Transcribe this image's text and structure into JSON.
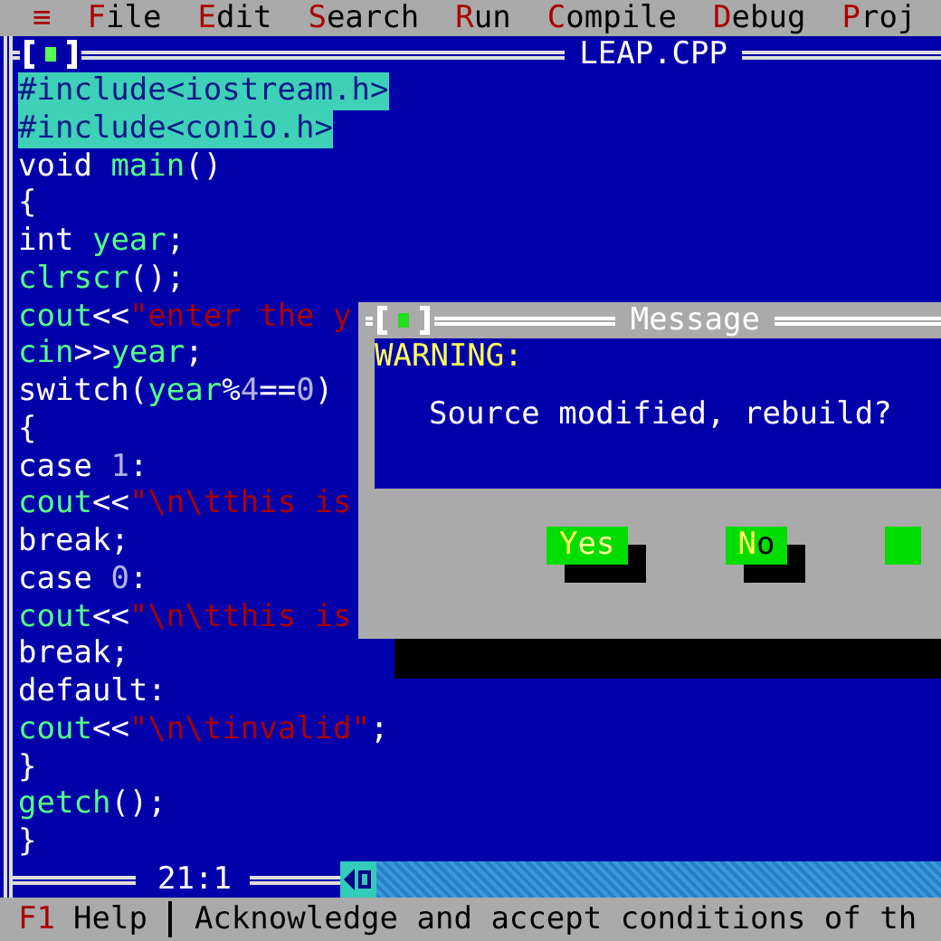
{
  "menu_bar": {
    "items": [
      {
        "label": "≡",
        "kind": "system"
      },
      {
        "label": "File",
        "kind": "menu"
      },
      {
        "label": "Edit",
        "kind": "menu"
      },
      {
        "label": "Search",
        "kind": "menu"
      },
      {
        "label": "Run",
        "kind": "menu"
      },
      {
        "label": "Compile",
        "kind": "menu"
      },
      {
        "label": "Debug",
        "kind": "menu"
      },
      {
        "label": "Proj",
        "kind": "menu"
      }
    ]
  },
  "editor": {
    "title": "LEAP.CPP",
    "cursor_position": "21:1",
    "lines": [
      {
        "selected": true,
        "segments": [
          {
            "text": "#include<iostream.h>"
          }
        ]
      },
      {
        "selected": true,
        "segments": [
          {
            "text": "#include<conio.h>"
          }
        ]
      },
      {
        "selected": false,
        "segments": [
          {
            "text": "void ",
            "kind": "plain"
          },
          {
            "text": "main",
            "kind": "ident"
          },
          {
            "text": "()",
            "kind": "plain"
          }
        ]
      },
      {
        "selected": false,
        "segments": [
          {
            "text": "{",
            "kind": "plain"
          }
        ]
      },
      {
        "selected": false,
        "segments": [
          {
            "text": "int ",
            "kind": "plain"
          },
          {
            "text": "year",
            "kind": "ident"
          },
          {
            "text": ";",
            "kind": "plain"
          }
        ]
      },
      {
        "selected": false,
        "segments": [
          {
            "text": "clrscr",
            "kind": "ident"
          },
          {
            "text": "();",
            "kind": "plain"
          }
        ]
      },
      {
        "selected": false,
        "segments": [
          {
            "text": "cout",
            "kind": "ident"
          },
          {
            "text": "<<",
            "kind": "plain"
          },
          {
            "text": "\"enter the y",
            "kind": "string"
          }
        ]
      },
      {
        "selected": false,
        "segments": [
          {
            "text": "cin",
            "kind": "ident"
          },
          {
            "text": ">>",
            "kind": "plain"
          },
          {
            "text": "year",
            "kind": "ident"
          },
          {
            "text": ";",
            "kind": "plain"
          }
        ]
      },
      {
        "selected": false,
        "segments": [
          {
            "text": "switch(",
            "kind": "plain"
          },
          {
            "text": "year",
            "kind": "ident"
          },
          {
            "text": "%",
            "kind": "plain"
          },
          {
            "text": "4",
            "kind": "number"
          },
          {
            "text": "==",
            "kind": "plain"
          },
          {
            "text": "0",
            "kind": "number"
          },
          {
            "text": ")",
            "kind": "plain"
          }
        ]
      },
      {
        "selected": false,
        "segments": [
          {
            "text": "{",
            "kind": "plain"
          }
        ]
      },
      {
        "selected": false,
        "segments": [
          {
            "text": "case ",
            "kind": "plain"
          },
          {
            "text": "1",
            "kind": "number"
          },
          {
            "text": ":",
            "kind": "plain"
          }
        ]
      },
      {
        "selected": false,
        "segments": [
          {
            "text": "cout",
            "kind": "ident"
          },
          {
            "text": "<<",
            "kind": "plain"
          },
          {
            "text": "\"\\n\\tthis is",
            "kind": "string"
          }
        ]
      },
      {
        "selected": false,
        "segments": [
          {
            "text": "break;",
            "kind": "plain"
          }
        ]
      },
      {
        "selected": false,
        "segments": [
          {
            "text": "case ",
            "kind": "plain"
          },
          {
            "text": "0",
            "kind": "number"
          },
          {
            "text": ":",
            "kind": "plain"
          }
        ]
      },
      {
        "selected": false,
        "segments": [
          {
            "text": "cout",
            "kind": "ident"
          },
          {
            "text": "<<",
            "kind": "plain"
          },
          {
            "text": "\"\\n\\tthis is",
            "kind": "string"
          }
        ]
      },
      {
        "selected": false,
        "segments": [
          {
            "text": "break;",
            "kind": "plain"
          }
        ]
      },
      {
        "selected": false,
        "segments": [
          {
            "text": "default:",
            "kind": "plain"
          }
        ]
      },
      {
        "selected": false,
        "segments": [
          {
            "text": "cout",
            "kind": "ident"
          },
          {
            "text": "<<",
            "kind": "plain"
          },
          {
            "text": "\"\\n\\tinvalid\"",
            "kind": "string"
          },
          {
            "text": ";",
            "kind": "plain"
          }
        ]
      },
      {
        "selected": false,
        "segments": [
          {
            "text": "}",
            "kind": "plain"
          }
        ]
      },
      {
        "selected": false,
        "segments": [
          {
            "text": "getch",
            "kind": "ident"
          },
          {
            "text": "();",
            "kind": "plain"
          }
        ]
      },
      {
        "selected": false,
        "segments": [
          {
            "text": "}",
            "kind": "plain"
          }
        ]
      }
    ]
  },
  "dialog": {
    "title": "Message",
    "heading": "WARNING:",
    "message": "Source modified, rebuild?",
    "buttons": [
      {
        "label": "Yes",
        "selected": true
      },
      {
        "label": "No",
        "selected": false
      }
    ]
  },
  "status_bar": {
    "key": "F1",
    "label": "Help",
    "message": "Acknowledge and accept conditions of th"
  }
}
